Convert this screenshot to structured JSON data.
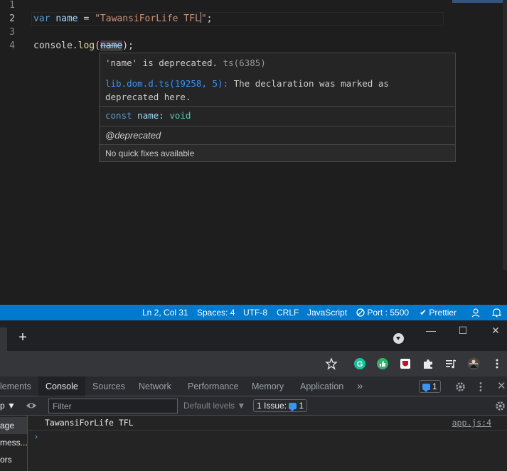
{
  "editor": {
    "lines": [
      {
        "num": "1"
      },
      {
        "num": "2",
        "kw": "var",
        "name": "name",
        "eq": " = ",
        "str_open": "\"TawansiForLife TFL",
        "str_close": "\"",
        "semi": ";"
      },
      {
        "num": "3"
      },
      {
        "num": "4",
        "obj": "console",
        "dot": ".",
        "method": "log",
        "paren_open": "(",
        "arg": "name",
        "paren_close": ");"
      }
    ]
  },
  "hover": {
    "message": "'name' is deprecated.",
    "code": "ts(6385)",
    "related_link": "lib.dom.d.ts(19258, 5):",
    "related_text": "The declaration was marked as",
    "related_text2": "deprecated here.",
    "sig_kw": "const",
    "sig_name": "name",
    "sig_colon": ":",
    "sig_type": "void",
    "tag": "@deprecated",
    "footer": "No quick fixes available"
  },
  "statusbar": {
    "position": "Ln 2, Col 31",
    "spaces": "Spaces: 4",
    "encoding": "UTF-8",
    "eol": "CRLF",
    "language": "JavaScript",
    "port": "Port : 5500",
    "prettier": "Prettier"
  },
  "browser": {
    "newtab_label": "+",
    "min_label": "—",
    "max_label": "☐",
    "close_label": "✕"
  },
  "devtools": {
    "tabs": [
      "lements",
      "Console",
      "Sources",
      "Network",
      "Performance",
      "Memory",
      "Application"
    ],
    "more_tabs": "»",
    "issues_count": "1",
    "context_label": "p ▼",
    "filter_placeholder": "Filter",
    "levels": "Default levels ▼",
    "issue_label": "1 Issue:",
    "issue_count": "1",
    "sidebar": [
      "age",
      "mess...",
      "ors"
    ],
    "log": {
      "message": "TawansiForLife TFL",
      "source": "app.js:4"
    },
    "prompt": "›"
  },
  "colors": {
    "accent": "#007acc",
    "link": "#3794ff",
    "type": "#4ec9b0"
  }
}
